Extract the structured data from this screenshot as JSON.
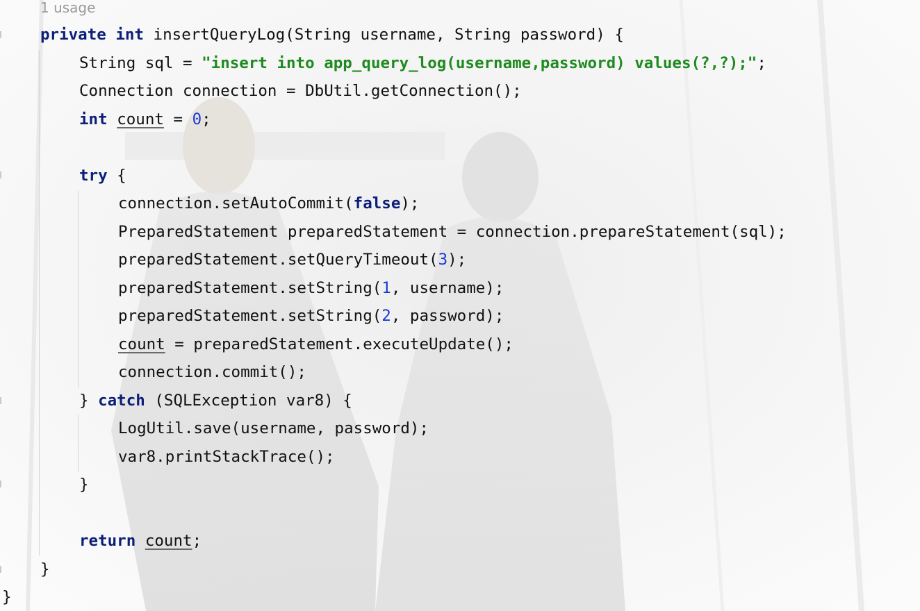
{
  "editor": {
    "usage_hint": "1 usage",
    "lines": [
      {
        "indent": 0,
        "segments": [
          {
            "t": "private",
            "k": "kw"
          },
          {
            "t": " "
          },
          {
            "t": "int",
            "k": "kw"
          },
          {
            "t": " insertQueryLog(String username, String password) {"
          }
        ]
      },
      {
        "indent": 1,
        "segments": [
          {
            "t": "String sql = "
          },
          {
            "t": "\"insert into app_query_log(username,password) values(?,?);\"",
            "k": "str"
          },
          {
            "t": ";"
          }
        ]
      },
      {
        "indent": 1,
        "segments": [
          {
            "t": "Connection connection = DbUtil.getConnection();"
          }
        ]
      },
      {
        "indent": 1,
        "segments": [
          {
            "t": "int",
            "k": "kw"
          },
          {
            "t": " "
          },
          {
            "t": "count",
            "k": "ul"
          },
          {
            "t": " = "
          },
          {
            "t": "0",
            "k": "num"
          },
          {
            "t": ";"
          }
        ]
      },
      {
        "indent": 0,
        "segments": []
      },
      {
        "indent": 1,
        "segments": [
          {
            "t": "try",
            "k": "kw"
          },
          {
            "t": " {"
          }
        ]
      },
      {
        "indent": 2,
        "segments": [
          {
            "t": "connection.setAutoCommit("
          },
          {
            "t": "false",
            "k": "kw"
          },
          {
            "t": ");"
          }
        ]
      },
      {
        "indent": 2,
        "segments": [
          {
            "t": "PreparedStatement preparedStatement = connection.prepareStatement(sql);"
          }
        ]
      },
      {
        "indent": 2,
        "segments": [
          {
            "t": "preparedStatement.setQueryTimeout("
          },
          {
            "t": "3",
            "k": "num"
          },
          {
            "t": ");"
          }
        ]
      },
      {
        "indent": 2,
        "segments": [
          {
            "t": "preparedStatement.setString("
          },
          {
            "t": "1",
            "k": "num"
          },
          {
            "t": ", username);"
          }
        ]
      },
      {
        "indent": 2,
        "segments": [
          {
            "t": "preparedStatement.setString("
          },
          {
            "t": "2",
            "k": "num"
          },
          {
            "t": ", password);"
          }
        ]
      },
      {
        "indent": 2,
        "segments": [
          {
            "t": "count",
            "k": "ul"
          },
          {
            "t": " = preparedStatement.executeUpdate();"
          }
        ]
      },
      {
        "indent": 2,
        "segments": [
          {
            "t": "connection.commit();"
          }
        ]
      },
      {
        "indent": 1,
        "segments": [
          {
            "t": "} "
          },
          {
            "t": "catch",
            "k": "kw"
          },
          {
            "t": " (SQLException var8) {"
          }
        ]
      },
      {
        "indent": 2,
        "segments": [
          {
            "t": "LogUtil.save(username, password);"
          }
        ]
      },
      {
        "indent": 2,
        "segments": [
          {
            "t": "var8.printStackTrace();"
          }
        ]
      },
      {
        "indent": 1,
        "segments": [
          {
            "t": "}"
          }
        ]
      },
      {
        "indent": 0,
        "segments": []
      },
      {
        "indent": 1,
        "segments": [
          {
            "t": "return",
            "k": "kw"
          },
          {
            "t": " "
          },
          {
            "t": "count",
            "k": "ul"
          },
          {
            "t": ";"
          }
        ]
      },
      {
        "indent": 0,
        "segments": [
          {
            "t": "}"
          }
        ]
      },
      {
        "indent": -1,
        "segments": [
          {
            "t": "}"
          }
        ]
      }
    ]
  },
  "colors": {
    "keyword": "#0b1f78",
    "string": "#1f8a1f",
    "number": "#1a39d6",
    "text": "#111111",
    "usage_hint": "#9a9a9a"
  }
}
